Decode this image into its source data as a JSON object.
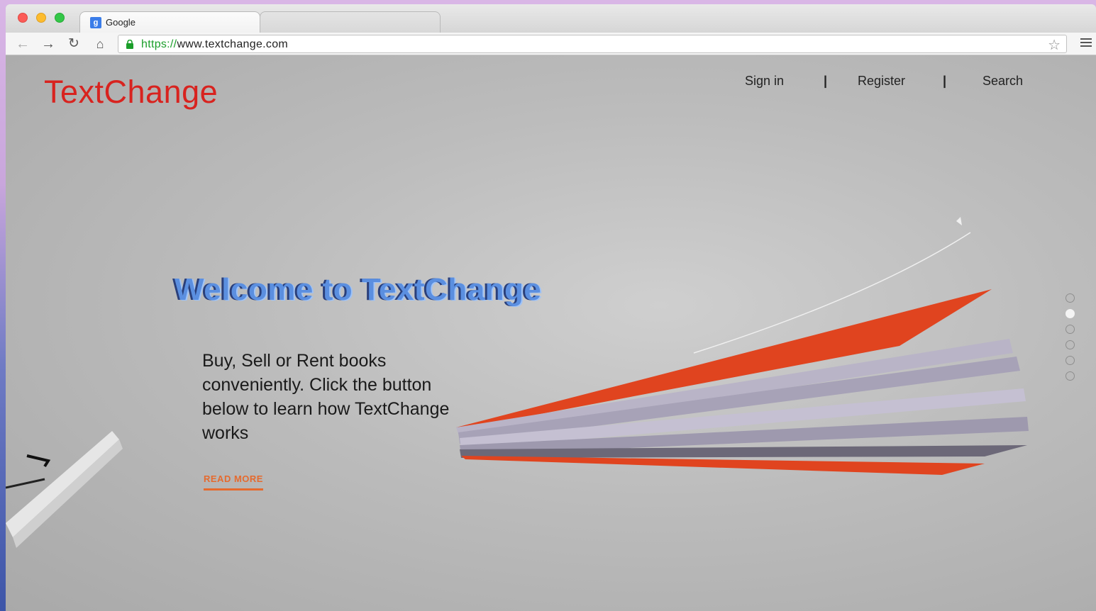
{
  "browser": {
    "tabs": [
      {
        "title": "Google",
        "favicon": "g-favicon-icon"
      },
      {
        "title": ""
      }
    ],
    "url_scheme": "https://",
    "url_host": "www.textchange.com"
  },
  "site": {
    "logo": "TextChange",
    "nav": {
      "signin": "Sign in",
      "separator": "|",
      "register": "Register",
      "search": "Search"
    }
  },
  "hero": {
    "heading": "Welcome to TextChange",
    "tagline": "Buy, Sell or Rent books conveniently. Click the button below to learn how TextChange works",
    "cta": "READ MORE"
  },
  "carousel": {
    "slide_count": 6,
    "active_index": 1
  },
  "colors": {
    "brand": "#d8231f",
    "accent": "#e56a2e",
    "heading": "#5b8fe0"
  }
}
